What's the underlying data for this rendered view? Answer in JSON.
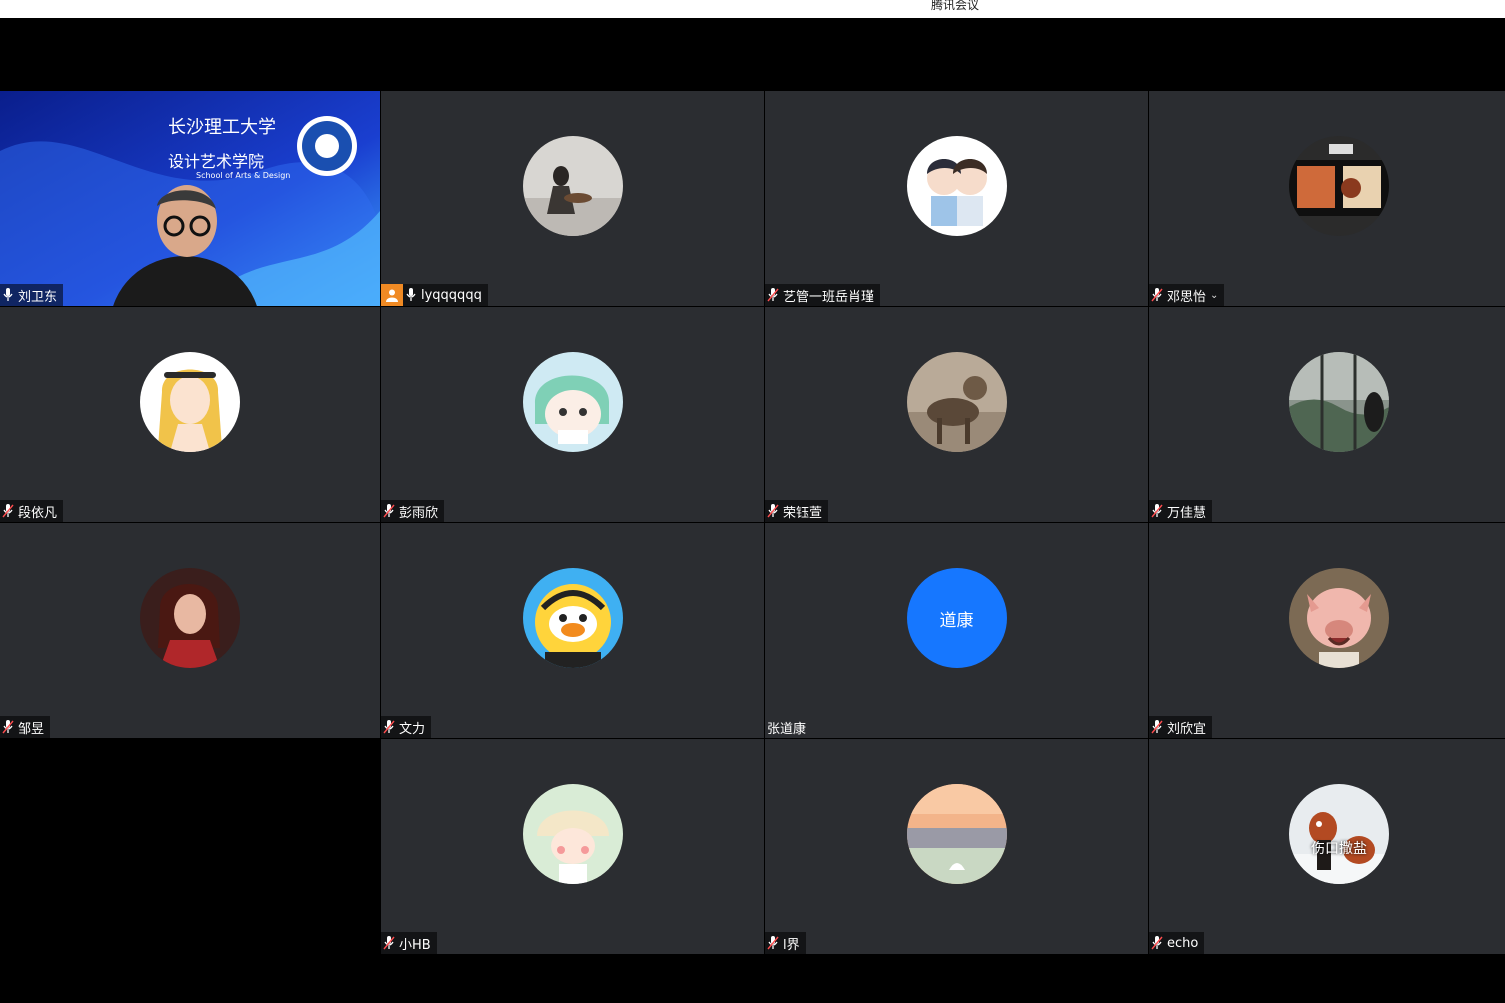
{
  "window": {
    "title": "腾讯会议"
  },
  "colors": {
    "tile_bg": "#2b2d31",
    "avatar_blue": "#1677ff",
    "host_orange": "#f08a24"
  },
  "video_tile": {
    "name": "刘卫东",
    "banner_line1": "长沙理工大学",
    "banner_line2": "设计艺术学院",
    "banner_line3": "School of Arts & Design"
  },
  "participants": [
    {
      "name": "lyqqqqqq",
      "avatar": "photo-girl-guitar",
      "host": true
    },
    {
      "name": "艺管一班岳肖瑾",
      "avatar": "cartoon-boys"
    },
    {
      "name": "邓思怡",
      "avatar": "photo-window",
      "chevron": true
    },
    {
      "name": "段依凡",
      "avatar": "cartoon-blonde"
    },
    {
      "name": "彭雨欣",
      "avatar": "cartoon-green-hair"
    },
    {
      "name": "荣钰萱",
      "avatar": "photo-deer"
    },
    {
      "name": "万佳慧",
      "avatar": "photo-rain-window"
    },
    {
      "name": "邹昱",
      "avatar": "photo-woman-red"
    },
    {
      "name": "文力",
      "avatar": "cartoon-bee"
    },
    {
      "name": "张道康",
      "avatar": "initials",
      "initials": "道康",
      "no_mic": true
    },
    {
      "name": "刘欣宜",
      "avatar": "photo-pig"
    },
    {
      "name": "小HB",
      "avatar": "cartoon-hat-girl"
    },
    {
      "name": "l界",
      "avatar": "photo-sunset"
    },
    {
      "name": "echo",
      "avatar": "photo-red-panda",
      "overlay": "伤口撒盐"
    }
  ]
}
